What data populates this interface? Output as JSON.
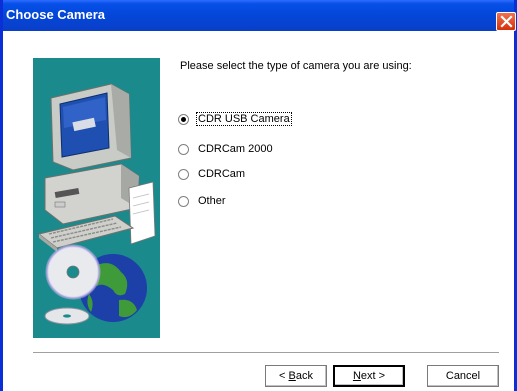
{
  "window": {
    "title": "Choose Camera",
    "accent_color": "#0b2fd6",
    "close_icon": "close-icon"
  },
  "illustration": {
    "icon": "computer-with-cds-and-globe-illustration",
    "background_color": "#1a8a8d"
  },
  "prompt": "Please select the type of camera you are using:",
  "camera_options": [
    {
      "label": "CDR USB Camera",
      "selected": true
    },
    {
      "label": "CDRCam 2000",
      "selected": false
    },
    {
      "label": "CDRCam",
      "selected": false
    },
    {
      "label": "Other",
      "selected": false
    }
  ],
  "buttons": {
    "back": {
      "mnemonic": "B",
      "rest": "ack",
      "prefix": "< "
    },
    "next": {
      "mnemonic": "N",
      "rest": "ext",
      "suffix": " >"
    },
    "cancel": {
      "label": "Cancel"
    }
  }
}
